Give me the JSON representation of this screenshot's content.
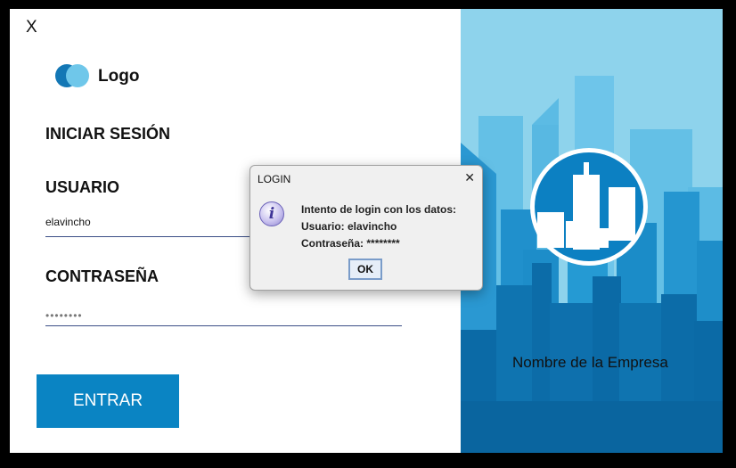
{
  "window": {
    "close_label": "X"
  },
  "logo": {
    "text": "Logo"
  },
  "login_form": {
    "title": "INICIAR SESIÓN",
    "user_label": "USUARIO",
    "user_value": "elavincho",
    "password_label": "CONTRASEÑA",
    "password_value": "••••••••",
    "submit_label": "ENTRAR"
  },
  "brand_panel": {
    "company_name": "Nombre de la Empresa"
  },
  "dialog": {
    "title": "LOGIN",
    "close_label": "✕",
    "icon": "info-icon",
    "icon_glyph": "i",
    "line1": "Intento de login con los datos:",
    "line2": "Usuario: elavincho",
    "line3": "Contraseña: ********",
    "ok_label": "OK"
  },
  "colors": {
    "primary": "#0a84c3",
    "sky": "#8ed3ec",
    "building_light": "#45b1e0",
    "building_mid": "#1e8ec9",
    "building_dark": "#0b6aa6",
    "field_underline": "#3b4e86"
  }
}
